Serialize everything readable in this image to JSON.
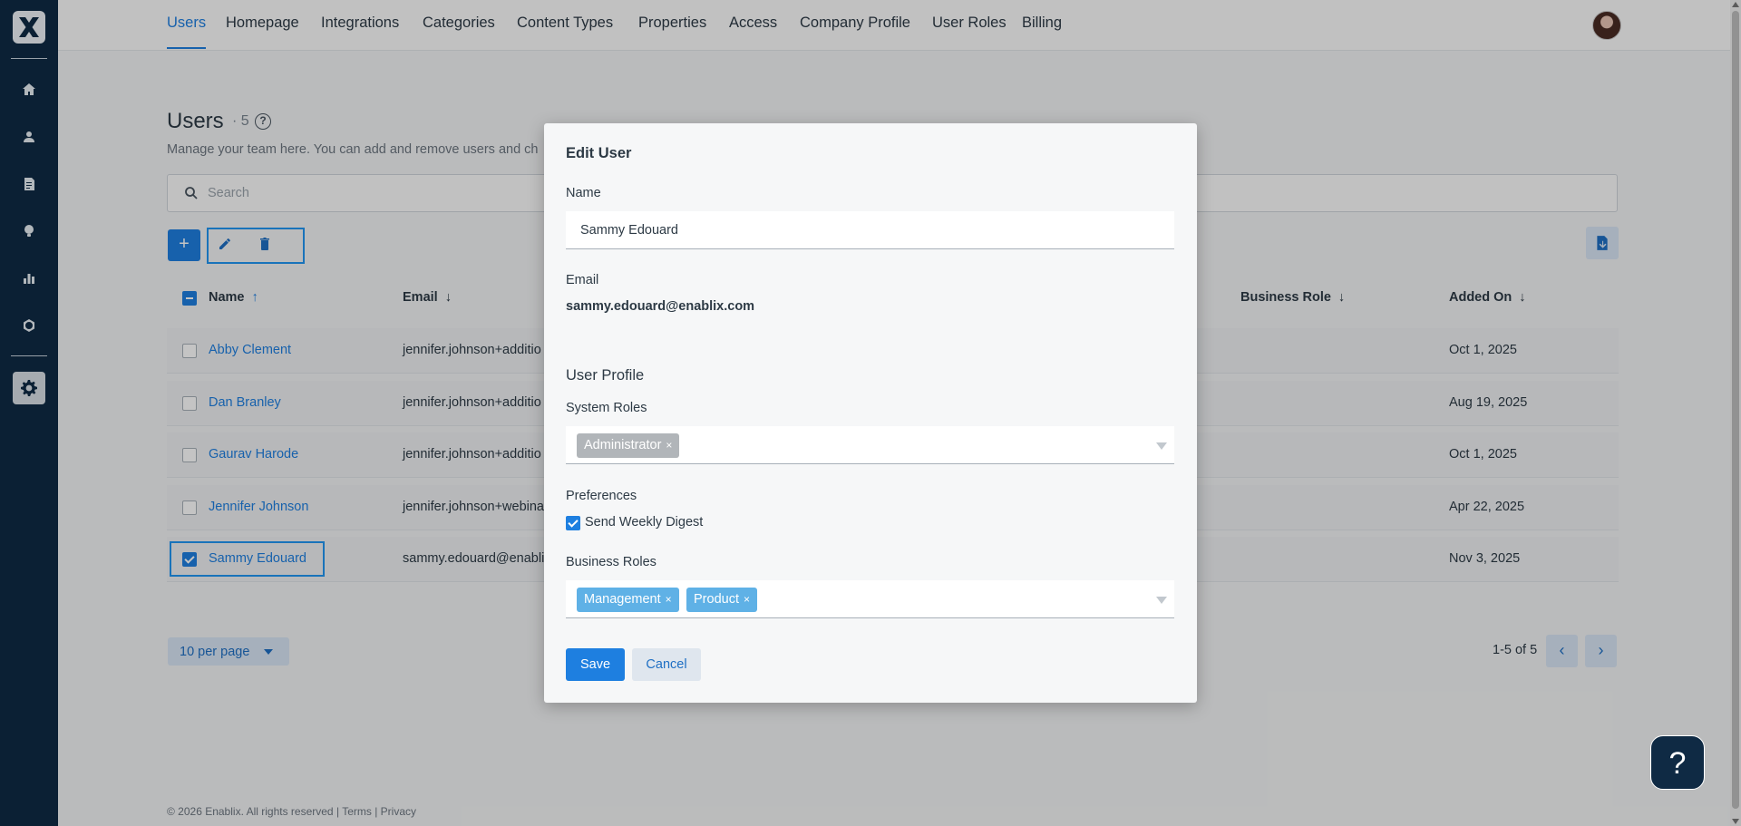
{
  "sidebar": {
    "logo_icon": "enablix-x-logo",
    "items": [
      {
        "icon": "home-icon"
      },
      {
        "icon": "user-icon"
      },
      {
        "icon": "document-icon"
      },
      {
        "icon": "lightbulb-icon"
      },
      {
        "icon": "bar-chart-icon"
      },
      {
        "icon": "badge-icon"
      },
      {
        "icon": "gear-icon",
        "active": true
      }
    ]
  },
  "topnav": {
    "tabs": [
      "Users",
      "Homepage",
      "Integrations",
      "Categories",
      "Content Types",
      "Properties",
      "Access",
      "Company Profile",
      "User Roles",
      "Billing"
    ],
    "active_tab": "Users"
  },
  "page": {
    "title": "Users",
    "count": "· 5",
    "subtitle": "Manage your team here. You can add and remove users and ch",
    "search_placeholder": "Search"
  },
  "table": {
    "headers": {
      "name": "Name",
      "email": "Email",
      "business_role": "Business Role",
      "added_on": "Added On"
    },
    "rows": [
      {
        "name": "Abby Clement",
        "email": "jennifer.johnson+additio",
        "added": "Oct 1, 2025",
        "checked": false
      },
      {
        "name": "Dan Branley",
        "email": "jennifer.johnson+additio",
        "added": "Aug 19, 2025",
        "checked": false
      },
      {
        "name": "Gaurav Harode",
        "email": "jennifer.johnson+additio",
        "added": "Oct 1, 2025",
        "checked": false
      },
      {
        "name": "Jennifer Johnson",
        "email": "jennifer.johnson+webina",
        "added": "Apr 22, 2025",
        "checked": false
      },
      {
        "name": "Sammy Edouard",
        "email": "sammy.edouard@enabli",
        "added": "Nov 3, 2025",
        "checked": true
      }
    ]
  },
  "pagination": {
    "per_page": "10 per page",
    "info": "1-5 of 5",
    "prev": "‹",
    "next": "›"
  },
  "footer": {
    "copyright": "© 2026 Enablix. All rights reserved |",
    "terms": "Terms",
    "sep": "|",
    "privacy": "Privacy"
  },
  "modal": {
    "title": "Edit User",
    "name_label": "Name",
    "name_value": "Sammy Edouard",
    "email_label": "Email",
    "email_value": "sammy.edouard@enablix.com",
    "section_title": "User Profile",
    "system_roles_label": "System Roles",
    "system_roles": [
      "Administrator"
    ],
    "preferences_label": "Preferences",
    "weekly_digest_label": "Send Weekly Digest",
    "weekly_digest_checked": true,
    "business_roles_label": "Business Roles",
    "business_roles": [
      "Management",
      "Product"
    ],
    "chip_remove": "×",
    "save_label": "Save",
    "cancel_label": "Cancel"
  },
  "help_fab": "?",
  "colors": {
    "primary": "#1e7fe0",
    "sidebar": "#0f2a44",
    "chip_blue": "#5fb1e6",
    "chip_gray": "#b1b5b9"
  }
}
